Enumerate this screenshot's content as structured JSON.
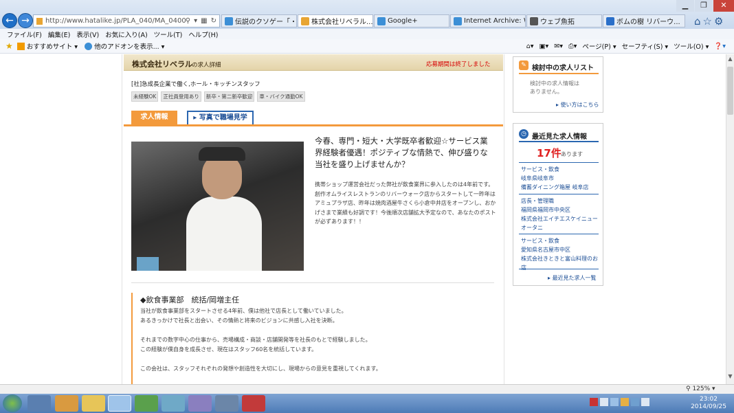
{
  "browser": {
    "address": "http://www.hatalike.jp/PLA_040/MA_04002/SA",
    "tabs": [
      {
        "label": "伝説のクソゲー「・...",
        "active": false
      },
      {
        "label": "株式会社リベラル...",
        "active": true
      },
      {
        "label": "Google+",
        "active": false
      },
      {
        "label": "Internet Archive: W...",
        "active": false
      },
      {
        "label": "ウェブ魚拓",
        "active": false
      },
      {
        "label": "ボムの樹 リバーウ...",
        "active": false
      }
    ],
    "menus": [
      "ファイル(F)",
      "編集(E)",
      "表示(V)",
      "お気に入り(A)",
      "ツール(T)",
      "ヘルプ(H)"
    ],
    "fav_items": [
      "おすすめサイト ▾",
      "他のアドオンを表示... ▾"
    ],
    "cmd_items": [
      "ページ(P) ▾",
      "セーフティ(S) ▾",
      "ツール(O) ▾"
    ],
    "zoom": "125%"
  },
  "page": {
    "company_title": "株式会社リベラル",
    "company_suffix": "の求人詳細",
    "closed_notice": "応募期間は終了しました",
    "catch": "[社]急成長企業で働く,ホール・キッチンスタッフ",
    "tags": [
      "未経験OK",
      "正社員登用あり",
      "新卒・第二新卒歓迎",
      "車・バイク通勤OK"
    ],
    "tab_info": "求人情報",
    "tab_photo": "写真で職場見学",
    "headline": "今春、専門・短大・大学既卒者歓迎☆サービス業界経験者優遇！ポジティブな情熱で、伸び盛りな当社を盛り上げませんか？",
    "intro": "携帯ショップ運営会社だった弊社が飲食業界に参入したのは4年前です。創作オムライスレストランのリバーウォーク店からスタートして一昨年はアミュプラザ店、昨年は焼肉酒屋牛さくら小倉中井店をオープンし、おかげさまで業績も好調です！今後順次店舗拡大予定なので、あなたのポストが必ずあります！！",
    "section_head": "◆飲食事業部　統括/岡増主任",
    "paras": [
      "当社が飲食事業部をスタートさせる4年前、僕は他社で店長として働いていました。",
      "あるきっかけで社長と出会い、その情熱と将来のビジョンに共感し入社を決断。",
      "",
      "それまでの数字中心の仕事から、売場構成・商談・店舗開発等を社長のもとで経験しました。",
      "この経験が僕自身を成長させ、現在はスタッフ60名を統括しています。",
      "",
      "この会社は、スタッフそれぞれの発想や創造性を大切にし、現場からの意見を重視してくれます。"
    ]
  },
  "side": {
    "consider_title": "検討中の求人リスト",
    "consider_empty": "検討中の求人情報はありません。",
    "consider_link": "使い方はこちら",
    "recent_title": "最近見た求人情報",
    "recent_count": "17件",
    "recent_count_suffix": "あります",
    "recent_items": [
      {
        "cat": "サービス・飲食",
        "area": "岐阜県岐阜市",
        "name": "備蓄ダイニング箱屋 岐阜店"
      },
      {
        "cat": "店長・管理職",
        "area": "福岡県福岡市中央区",
        "name": "株式会社エイチエスケイニューオータニ"
      },
      {
        "cat": "サービス・飲食",
        "area": "愛知県名古屋市中区",
        "name": "株式会社きときと富山料理のお店"
      }
    ],
    "recent_link": "最近見た求人一覧"
  },
  "taskbar": {
    "time": "23:02",
    "date": "2014/09/25"
  }
}
